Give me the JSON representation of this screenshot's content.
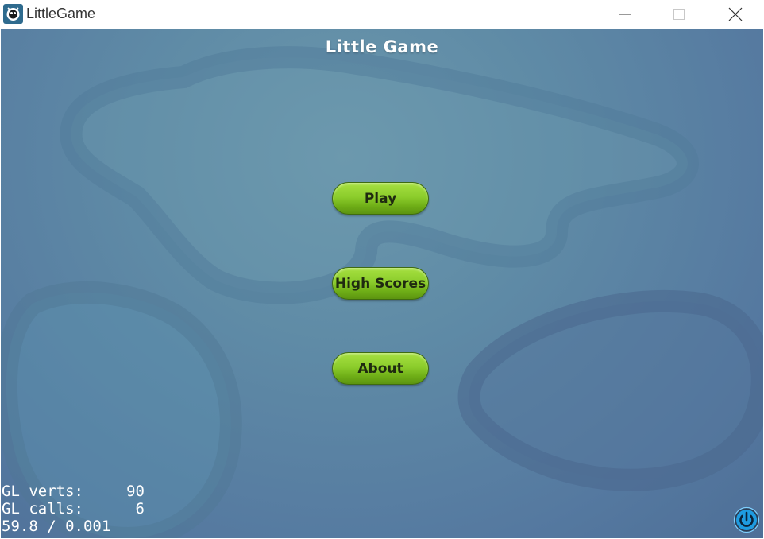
{
  "window": {
    "title": "LittleGame",
    "app_icon": "cocos-app-icon",
    "controls": {
      "minimize_icon": "minimize-icon",
      "maximize_icon": "maximize-icon",
      "close_icon": "close-icon"
    }
  },
  "game": {
    "title": "Little Game",
    "menu": {
      "play_label": "Play",
      "high_scores_label": "High Scores",
      "about_label": "About"
    },
    "stats": {
      "verts_label": "GL verts:",
      "verts_value": "90",
      "calls_label": "GL calls:",
      "calls_value": "6",
      "fps_text": "59.8 / 0.001"
    },
    "power_icon": "power-icon"
  },
  "colors": {
    "background": "#5f8ba6",
    "button_green": "#8ccd2c",
    "button_text": "#1f2a10",
    "power_blue": "#1e9be0"
  }
}
